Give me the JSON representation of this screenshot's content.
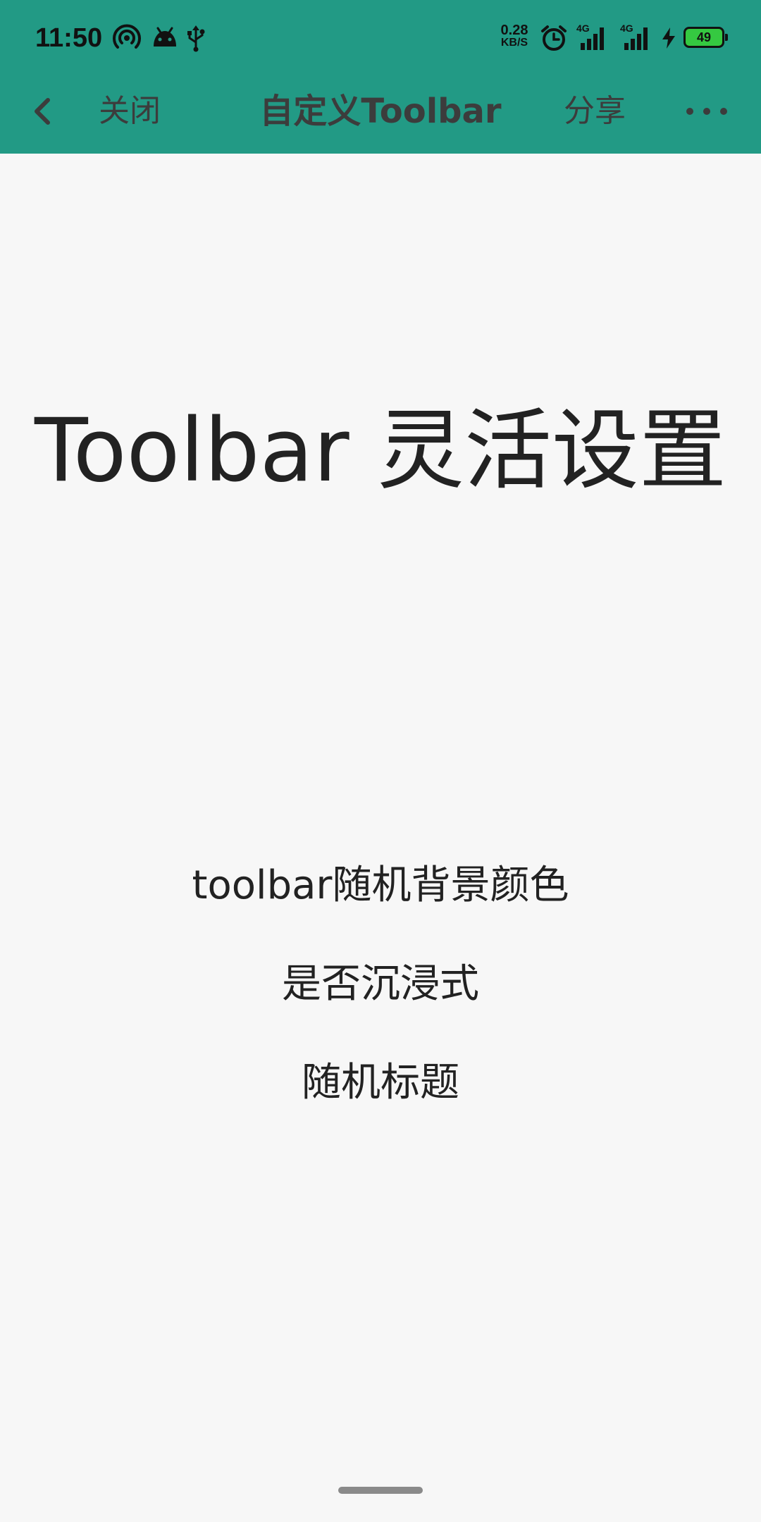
{
  "status_bar": {
    "time": "11:50",
    "net_speed_value": "0.28",
    "net_speed_unit": "KB/S",
    "signal1_label": "4G",
    "signal2_label": "4G",
    "battery_level": "49",
    "icons": [
      "hotspot-icon",
      "android-icon",
      "usb-icon",
      "alarm-icon",
      "signal-icon",
      "signal-icon",
      "charging-icon",
      "battery-icon"
    ]
  },
  "toolbar": {
    "back_icon": "chevron-left-icon",
    "close_label": "关闭",
    "title": "自定义Toolbar",
    "share_label": "分享",
    "more_icon": "more-horizontal-icon"
  },
  "content": {
    "hero_text": "Toolbar 灵活设置",
    "options": [
      "toolbar随机背景颜色",
      "是否沉浸式",
      "随机标题"
    ]
  },
  "colors": {
    "toolbar_background": "#229a85",
    "page_background": "#f7f7f7",
    "toolbar_text": "#3c3c3c",
    "body_text": "#222222",
    "battery_fill": "#35c941"
  }
}
